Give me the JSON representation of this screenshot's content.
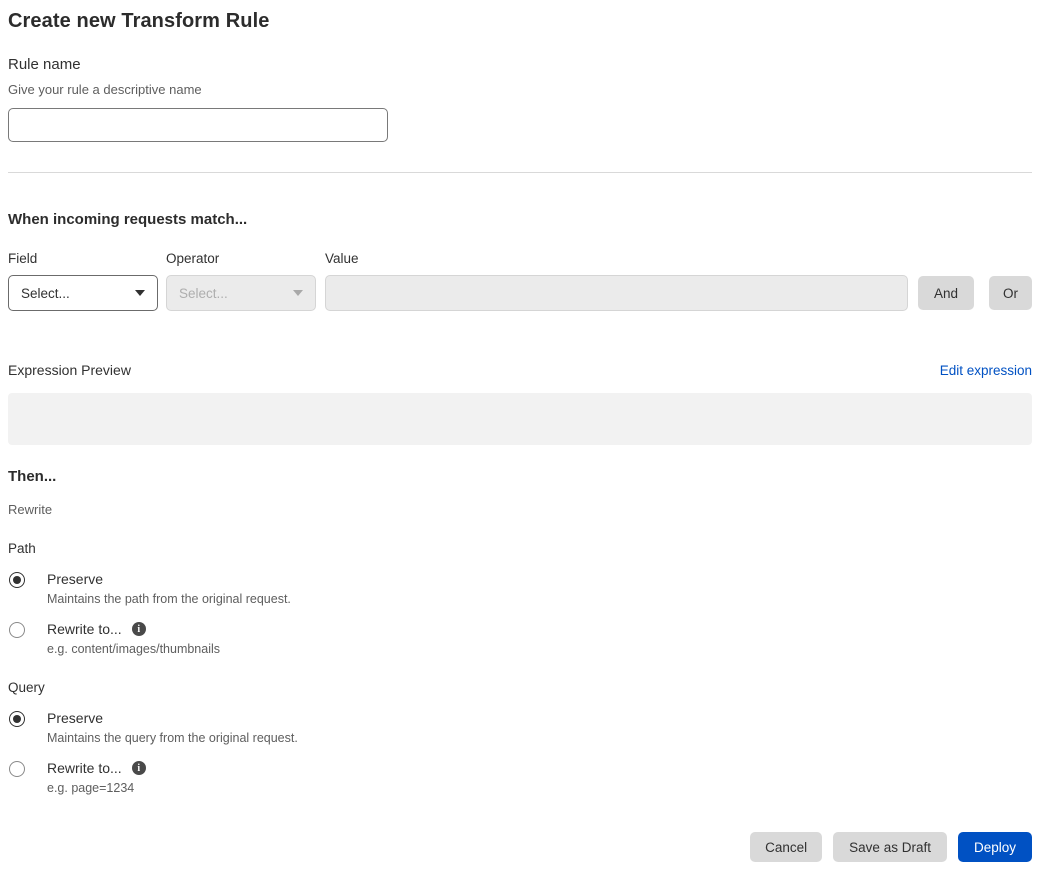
{
  "page": {
    "title": "Create new Transform Rule"
  },
  "rule_name": {
    "label": "Rule name",
    "help": "Give your rule a descriptive name",
    "value": "",
    "placeholder": ""
  },
  "match": {
    "heading": "When incoming requests match...",
    "field": {
      "label": "Field",
      "selected_value": "Select...",
      "enabled": true
    },
    "operator": {
      "label": "Operator",
      "selected_value": "Select...",
      "enabled": false
    },
    "value": {
      "label": "Value",
      "value": "",
      "enabled": false
    },
    "and_label": "And",
    "or_label": "Or"
  },
  "expression": {
    "label": "Expression Preview",
    "edit_link": "Edit expression",
    "content": ""
  },
  "then": {
    "heading": "Then...",
    "subheading": "Rewrite",
    "path": {
      "label": "Path",
      "options": [
        {
          "label": "Preserve",
          "description": "Maintains the path from the original request.",
          "selected": true,
          "has_info": false
        },
        {
          "label": "Rewrite to...",
          "description": "e.g. content/images/thumbnails",
          "selected": false,
          "has_info": true
        }
      ]
    },
    "query": {
      "label": "Query",
      "options": [
        {
          "label": "Preserve",
          "description": "Maintains the query from the original request.",
          "selected": true,
          "has_info": false
        },
        {
          "label": "Rewrite to...",
          "description": "e.g. page=1234",
          "selected": false,
          "has_info": true
        }
      ]
    }
  },
  "footer": {
    "cancel_label": "Cancel",
    "save_draft_label": "Save as Draft",
    "deploy_label": "Deploy"
  },
  "icons": {
    "info_glyph": "i"
  },
  "colors": {
    "primary_blue": "#0051c3",
    "link_blue": "#0051c3",
    "button_gray": "#d9d9d9",
    "disabled_bg": "#ebebeb",
    "preview_bg": "#f2f2f2",
    "text_main": "#313131",
    "text_muted": "#5e5e5e"
  }
}
